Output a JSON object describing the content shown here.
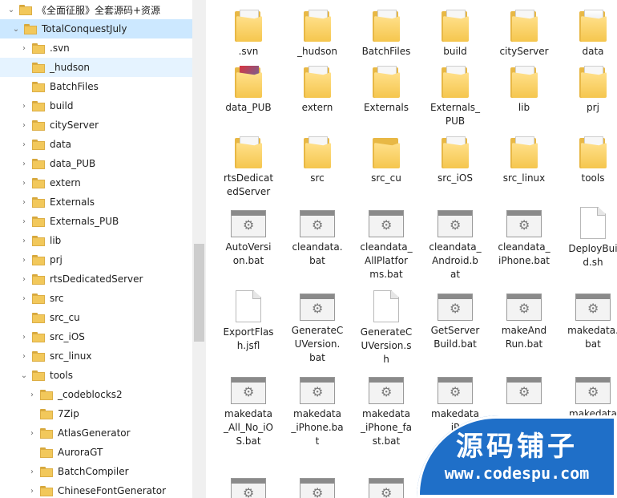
{
  "tree": [
    {
      "label": "《全面征服》全套源码+资源",
      "chev": "down",
      "level": 0,
      "state": ""
    },
    {
      "label": "TotalConquestJuly",
      "chev": "down",
      "level": 1,
      "state": "selected"
    },
    {
      "label": ".svn",
      "chev": "right",
      "level": 2,
      "state": ""
    },
    {
      "label": "_hudson",
      "chev": "",
      "level": 2,
      "state": "hover"
    },
    {
      "label": "BatchFiles",
      "chev": "",
      "level": 2,
      "state": ""
    },
    {
      "label": "build",
      "chev": "right",
      "level": 2,
      "state": ""
    },
    {
      "label": "cityServer",
      "chev": "right",
      "level": 2,
      "state": ""
    },
    {
      "label": "data",
      "chev": "right",
      "level": 2,
      "state": ""
    },
    {
      "label": "data_PUB",
      "chev": "right",
      "level": 2,
      "state": ""
    },
    {
      "label": "extern",
      "chev": "right",
      "level": 2,
      "state": ""
    },
    {
      "label": "Externals",
      "chev": "right",
      "level": 2,
      "state": ""
    },
    {
      "label": "Externals_PUB",
      "chev": "right",
      "level": 2,
      "state": ""
    },
    {
      "label": "lib",
      "chev": "right",
      "level": 2,
      "state": ""
    },
    {
      "label": "prj",
      "chev": "right",
      "level": 2,
      "state": ""
    },
    {
      "label": "rtsDedicatedServer",
      "chev": "right",
      "level": 2,
      "state": ""
    },
    {
      "label": "src",
      "chev": "right",
      "level": 2,
      "state": ""
    },
    {
      "label": "src_cu",
      "chev": "",
      "level": 2,
      "state": ""
    },
    {
      "label": "src_iOS",
      "chev": "right",
      "level": 2,
      "state": ""
    },
    {
      "label": "src_linux",
      "chev": "right",
      "level": 2,
      "state": ""
    },
    {
      "label": "tools",
      "chev": "down",
      "level": 2,
      "state": ""
    },
    {
      "label": "_codeblocks2",
      "chev": "right",
      "level": 3,
      "state": ""
    },
    {
      "label": "7Zip",
      "chev": "",
      "level": 3,
      "state": ""
    },
    {
      "label": "AtlasGenerator",
      "chev": "right",
      "level": 3,
      "state": ""
    },
    {
      "label": "AuroraGT",
      "chev": "",
      "level": 3,
      "state": ""
    },
    {
      "label": "BatchCompiler",
      "chev": "right",
      "level": 3,
      "state": ""
    },
    {
      "label": "ChineseFontGenerator",
      "chev": "right",
      "level": 3,
      "state": ""
    }
  ],
  "items": [
    {
      "label": ".svn",
      "icon": "folder"
    },
    {
      "label": "_hudson",
      "icon": "folder"
    },
    {
      "label": "BatchFiles",
      "icon": "folder"
    },
    {
      "label": "build",
      "icon": "folder"
    },
    {
      "label": "cityServer",
      "icon": "folder"
    },
    {
      "label": "data",
      "icon": "folder-dark"
    },
    {
      "label": "data_PUB",
      "icon": "folder-red"
    },
    {
      "label": "extern",
      "icon": "folder"
    },
    {
      "label": "Externals",
      "icon": "folder"
    },
    {
      "label": "Externals_\nPUB",
      "icon": "folder"
    },
    {
      "label": "lib",
      "icon": "folder"
    },
    {
      "label": "prj",
      "icon": "folder"
    },
    {
      "label": "rtsDedicat\nedServer",
      "icon": "folder"
    },
    {
      "label": "src",
      "icon": "folder"
    },
    {
      "label": "src_cu",
      "icon": "folder-empty"
    },
    {
      "label": "src_iOS",
      "icon": "folder"
    },
    {
      "label": "src_linux",
      "icon": "folder"
    },
    {
      "label": "tools",
      "icon": "folder"
    },
    {
      "label": "AutoVersi\non.bat",
      "icon": "bat"
    },
    {
      "label": "cleandata.\nbat",
      "icon": "bat"
    },
    {
      "label": "cleandata_\nAllPlatfor\nms.bat",
      "icon": "bat"
    },
    {
      "label": "cleandata_\nAndroid.b\nat",
      "icon": "bat"
    },
    {
      "label": "cleandata_\niPhone.bat",
      "icon": "bat"
    },
    {
      "label": "DeployBui\nd.sh",
      "icon": "doc"
    },
    {
      "label": "ExportFlas\nh.jsfl",
      "icon": "doc"
    },
    {
      "label": "GenerateC\nUVersion.\nbat",
      "icon": "bat"
    },
    {
      "label": "GenerateC\nUVersion.s\nh",
      "icon": "doc"
    },
    {
      "label": "GetServer\nBuild.bat",
      "icon": "bat"
    },
    {
      "label": "makeAnd\nRun.bat",
      "icon": "bat"
    },
    {
      "label": "makedata.\nbat",
      "icon": "bat"
    },
    {
      "label": "makedata\n_All_No_iO\nS.bat",
      "icon": "bat"
    },
    {
      "label": "makedata\n_iPhone.ba\nt",
      "icon": "bat"
    },
    {
      "label": "makedata\n_iPhone_fa\nst.bat",
      "icon": "bat"
    },
    {
      "label": "makedata\niP",
      "icon": "bat"
    },
    {
      "label": "",
      "icon": "bat"
    },
    {
      "label": "makedata",
      "icon": "bat"
    },
    {
      "label": "",
      "icon": "bat"
    },
    {
      "label": "",
      "icon": "bat"
    },
    {
      "label": "",
      "icon": "bat"
    }
  ],
  "watermark": {
    "title": "源码铺子",
    "url": "www.codespu.com"
  }
}
